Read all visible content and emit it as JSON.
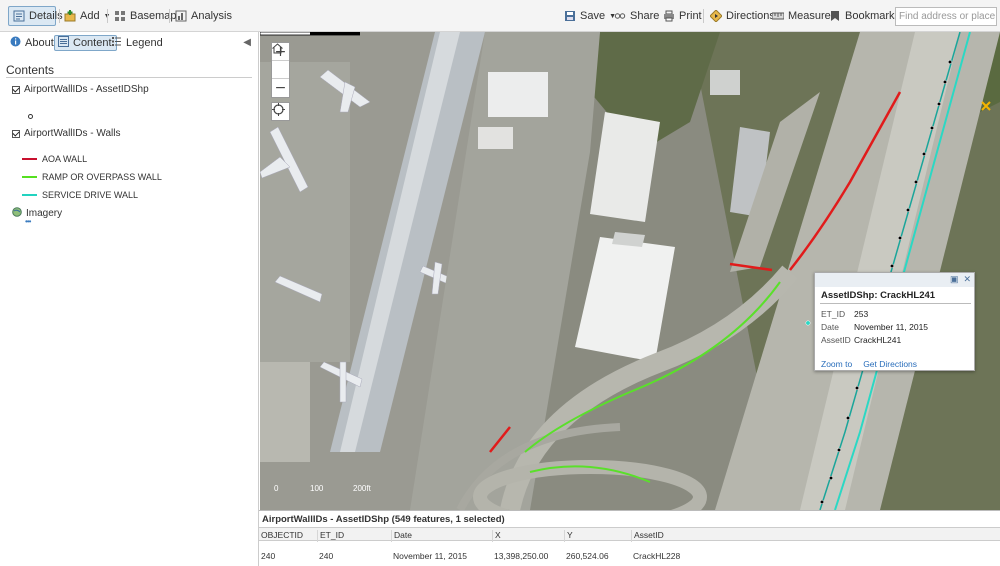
{
  "toolbar": {
    "details": "Details",
    "add": "Add",
    "basemap": "Basemap",
    "analysis": "Analysis",
    "save": "Save",
    "share": "Share",
    "print": "Print",
    "directions": "Directions",
    "measure": "Measure",
    "bookmarks": "Bookmarks",
    "search_placeholder": "Find address or place"
  },
  "panel": {
    "tabs": {
      "about": "About",
      "content": "Content",
      "legend": "Legend"
    },
    "contents_title": "Contents",
    "layers": [
      {
        "name": "AirportWallIDs - AssetIDShp"
      },
      {
        "name": "AirportWallIDs - Walls"
      },
      {
        "name": "Imagery"
      }
    ],
    "legend_items": [
      {
        "label": "AOA WALL",
        "color": "#c8102e"
      },
      {
        "label": "RAMP OR OVERPASS WALL",
        "color": "#55e020"
      },
      {
        "label": "SERVICE DRIVE WALL",
        "color": "#22d3c0"
      }
    ],
    "imagery_dots": "•••"
  },
  "map": {
    "scale_labels": [
      "0",
      "100",
      "200ft"
    ]
  },
  "popup": {
    "title": "AssetIDShp: CrackHL241",
    "fields": [
      {
        "key": "ET_ID",
        "value": "253"
      },
      {
        "key": "Date",
        "value": "November 11, 2015"
      },
      {
        "key": "AssetID",
        "value": "CrackHL241"
      }
    ],
    "zoom_to": "Zoom to",
    "get_directions": "Get Directions"
  },
  "table": {
    "title": "AirportWallIDs - AssetIDShp (549 features, 1 selected)",
    "headers": [
      "OBJECTID",
      "ET_ID",
      "Date",
      "X",
      "Y",
      "AssetID"
    ],
    "rows": [
      [
        "240",
        "240",
        "November 11, 2015",
        "13,398,250.00",
        "260,524.06",
        "CrackHL228"
      ]
    ]
  }
}
